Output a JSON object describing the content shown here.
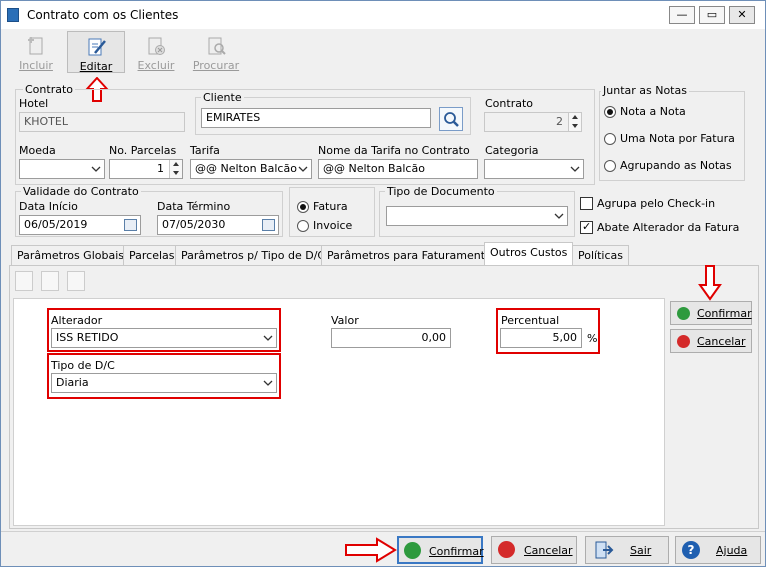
{
  "window": {
    "title": "Contrato com os Clientes",
    "controls": {
      "minimize": "—",
      "maximize": "▭",
      "close": "✕"
    }
  },
  "toolbar": {
    "incluir": "Incluir",
    "editar": "Editar",
    "excluir": "Excluir",
    "procurar": "Procurar"
  },
  "contrato_group": {
    "label": "Contrato"
  },
  "hotel": {
    "label": "Hotel",
    "value": "KHOTEL"
  },
  "cliente": {
    "label": "Cliente",
    "value": "EMIRATES"
  },
  "contrato": {
    "label": "Contrato",
    "value": "2"
  },
  "juntar_notas": {
    "label": "Juntar as Notas",
    "options": [
      "Nota a Nota",
      "Uma Nota por Fatura",
      "Agrupando as Notas"
    ],
    "selected": "Nota a Nota"
  },
  "moeda": {
    "label": "Moeda",
    "value": ""
  },
  "no_parcelas": {
    "label": "No. Parcelas",
    "value": "1"
  },
  "tarifa": {
    "label": "Tarifa",
    "value": "@@ Nelton Balcão"
  },
  "nome_tarifa": {
    "label": "Nome da Tarifa no Contrato",
    "value": "@@ Nelton Balcão"
  },
  "categoria": {
    "label": "Categoria",
    "value": ""
  },
  "validade": {
    "label": "Validade do Contrato",
    "inicio_label": "Data Início",
    "inicio": "06/05/2019",
    "termino_label": "Data Término",
    "termino": "07/05/2030"
  },
  "tipo_fatura": {
    "options": [
      "Fatura",
      "Invoice"
    ],
    "selected": "Fatura"
  },
  "tipo_documento": {
    "label": "Tipo de Documento",
    "value": ""
  },
  "agrupa_checkin": {
    "label": "Agrupa pelo Check-in",
    "checked": false
  },
  "abate_alterador": {
    "label": "Abate Alterador da Fatura",
    "checked": true
  },
  "tabs": [
    "Parâmetros Globais",
    "Parcelas",
    "Parâmetros p/ Tipo de D/C",
    "Parâmetros para Faturamento",
    "Outros Custos",
    "Políticas"
  ],
  "active_tab": "Outros Custos",
  "outros_custos": {
    "alterador_label": "Alterador",
    "alterador": "ISS RETIDO",
    "valor_label": "Valor",
    "valor": "0,00",
    "percentual_label": "Percentual",
    "percentual": "5,00",
    "percent_sign": "%",
    "tipo_dc_label": "Tipo de D/C",
    "tipo_dc": "Diaria",
    "confirmar": "Confirmar",
    "cancelar": "Cancelar"
  },
  "footer": {
    "confirmar": "Confirmar",
    "cancelar": "Cancelar",
    "sair": "Sair",
    "ajuda": "Ajuda"
  },
  "colors": {
    "highlight": "#e00000",
    "confirm_green": "#2e9a3e",
    "cancel_red": "#d42a2a",
    "help_blue": "#1f5fb0"
  }
}
